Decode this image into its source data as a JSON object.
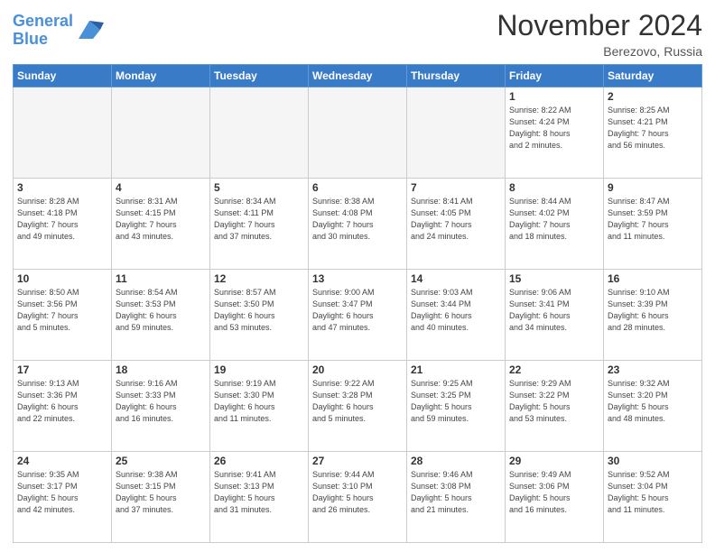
{
  "logo": {
    "text1": "General",
    "text2": "Blue"
  },
  "title": "November 2024",
  "location": "Berezovo, Russia",
  "days_header": [
    "Sunday",
    "Monday",
    "Tuesday",
    "Wednesday",
    "Thursday",
    "Friday",
    "Saturday"
  ],
  "weeks": [
    [
      {
        "day": "",
        "info": ""
      },
      {
        "day": "",
        "info": ""
      },
      {
        "day": "",
        "info": ""
      },
      {
        "day": "",
        "info": ""
      },
      {
        "day": "",
        "info": ""
      },
      {
        "day": "1",
        "info": "Sunrise: 8:22 AM\nSunset: 4:24 PM\nDaylight: 8 hours\nand 2 minutes."
      },
      {
        "day": "2",
        "info": "Sunrise: 8:25 AM\nSunset: 4:21 PM\nDaylight: 7 hours\nand 56 minutes."
      }
    ],
    [
      {
        "day": "3",
        "info": "Sunrise: 8:28 AM\nSunset: 4:18 PM\nDaylight: 7 hours\nand 49 minutes."
      },
      {
        "day": "4",
        "info": "Sunrise: 8:31 AM\nSunset: 4:15 PM\nDaylight: 7 hours\nand 43 minutes."
      },
      {
        "day": "5",
        "info": "Sunrise: 8:34 AM\nSunset: 4:11 PM\nDaylight: 7 hours\nand 37 minutes."
      },
      {
        "day": "6",
        "info": "Sunrise: 8:38 AM\nSunset: 4:08 PM\nDaylight: 7 hours\nand 30 minutes."
      },
      {
        "day": "7",
        "info": "Sunrise: 8:41 AM\nSunset: 4:05 PM\nDaylight: 7 hours\nand 24 minutes."
      },
      {
        "day": "8",
        "info": "Sunrise: 8:44 AM\nSunset: 4:02 PM\nDaylight: 7 hours\nand 18 minutes."
      },
      {
        "day": "9",
        "info": "Sunrise: 8:47 AM\nSunset: 3:59 PM\nDaylight: 7 hours\nand 11 minutes."
      }
    ],
    [
      {
        "day": "10",
        "info": "Sunrise: 8:50 AM\nSunset: 3:56 PM\nDaylight: 7 hours\nand 5 minutes."
      },
      {
        "day": "11",
        "info": "Sunrise: 8:54 AM\nSunset: 3:53 PM\nDaylight: 6 hours\nand 59 minutes."
      },
      {
        "day": "12",
        "info": "Sunrise: 8:57 AM\nSunset: 3:50 PM\nDaylight: 6 hours\nand 53 minutes."
      },
      {
        "day": "13",
        "info": "Sunrise: 9:00 AM\nSunset: 3:47 PM\nDaylight: 6 hours\nand 47 minutes."
      },
      {
        "day": "14",
        "info": "Sunrise: 9:03 AM\nSunset: 3:44 PM\nDaylight: 6 hours\nand 40 minutes."
      },
      {
        "day": "15",
        "info": "Sunrise: 9:06 AM\nSunset: 3:41 PM\nDaylight: 6 hours\nand 34 minutes."
      },
      {
        "day": "16",
        "info": "Sunrise: 9:10 AM\nSunset: 3:39 PM\nDaylight: 6 hours\nand 28 minutes."
      }
    ],
    [
      {
        "day": "17",
        "info": "Sunrise: 9:13 AM\nSunset: 3:36 PM\nDaylight: 6 hours\nand 22 minutes."
      },
      {
        "day": "18",
        "info": "Sunrise: 9:16 AM\nSunset: 3:33 PM\nDaylight: 6 hours\nand 16 minutes."
      },
      {
        "day": "19",
        "info": "Sunrise: 9:19 AM\nSunset: 3:30 PM\nDaylight: 6 hours\nand 11 minutes."
      },
      {
        "day": "20",
        "info": "Sunrise: 9:22 AM\nSunset: 3:28 PM\nDaylight: 6 hours\nand 5 minutes."
      },
      {
        "day": "21",
        "info": "Sunrise: 9:25 AM\nSunset: 3:25 PM\nDaylight: 5 hours\nand 59 minutes."
      },
      {
        "day": "22",
        "info": "Sunrise: 9:29 AM\nSunset: 3:22 PM\nDaylight: 5 hours\nand 53 minutes."
      },
      {
        "day": "23",
        "info": "Sunrise: 9:32 AM\nSunset: 3:20 PM\nDaylight: 5 hours\nand 48 minutes."
      }
    ],
    [
      {
        "day": "24",
        "info": "Sunrise: 9:35 AM\nSunset: 3:17 PM\nDaylight: 5 hours\nand 42 minutes."
      },
      {
        "day": "25",
        "info": "Sunrise: 9:38 AM\nSunset: 3:15 PM\nDaylight: 5 hours\nand 37 minutes."
      },
      {
        "day": "26",
        "info": "Sunrise: 9:41 AM\nSunset: 3:13 PM\nDaylight: 5 hours\nand 31 minutes."
      },
      {
        "day": "27",
        "info": "Sunrise: 9:44 AM\nSunset: 3:10 PM\nDaylight: 5 hours\nand 26 minutes."
      },
      {
        "day": "28",
        "info": "Sunrise: 9:46 AM\nSunset: 3:08 PM\nDaylight: 5 hours\nand 21 minutes."
      },
      {
        "day": "29",
        "info": "Sunrise: 9:49 AM\nSunset: 3:06 PM\nDaylight: 5 hours\nand 16 minutes."
      },
      {
        "day": "30",
        "info": "Sunrise: 9:52 AM\nSunset: 3:04 PM\nDaylight: 5 hours\nand 11 minutes."
      }
    ]
  ]
}
